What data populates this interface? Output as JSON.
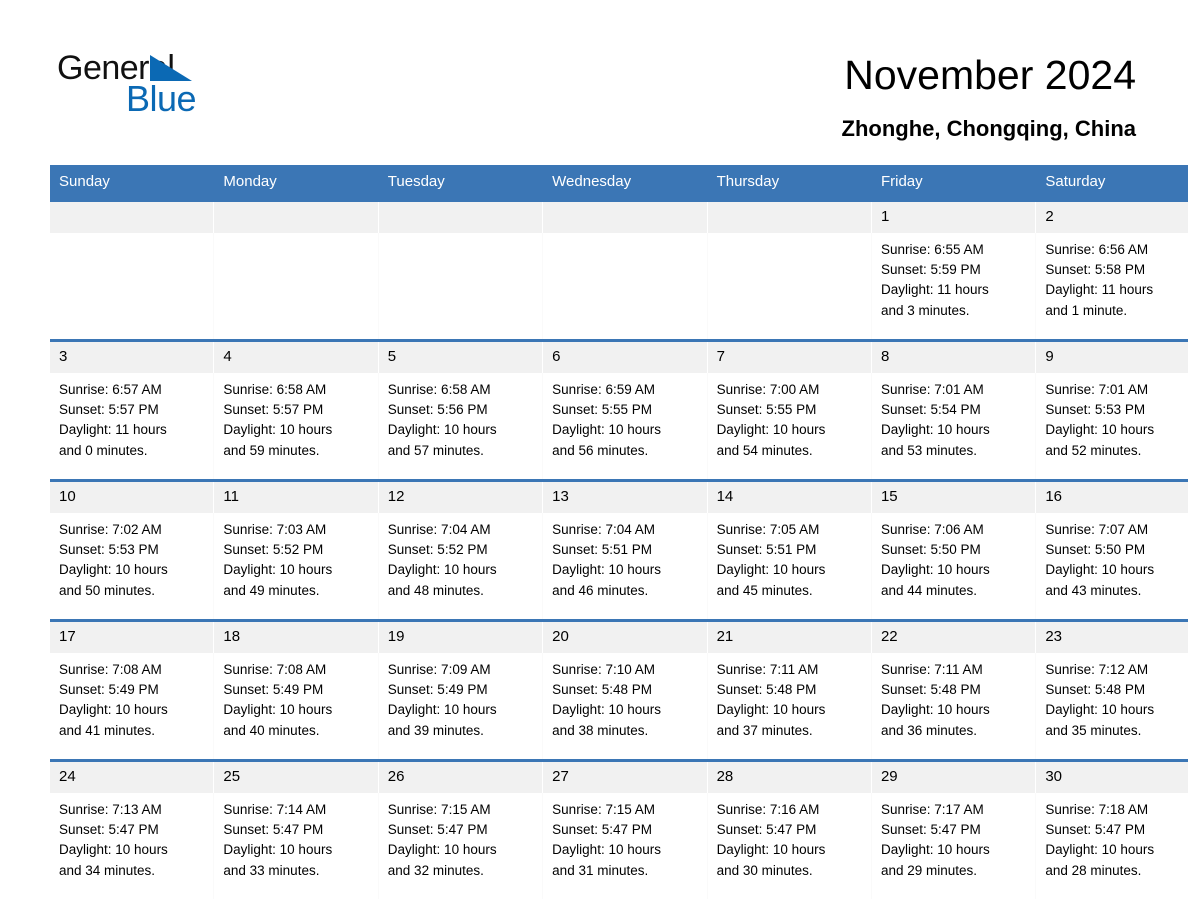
{
  "brand": {
    "name_part1": "General",
    "name_part2": "Blue",
    "triangle_color": "#0b69b4"
  },
  "header": {
    "title": "November 2024",
    "subtitle": "Zhonghe, Chongqing, China",
    "accent_color": "#3b76b5",
    "daynum_band_color": "#f1f1f1"
  },
  "weekday_headers": [
    "Sunday",
    "Monday",
    "Tuesday",
    "Wednesday",
    "Thursday",
    "Friday",
    "Saturday"
  ],
  "weeks": [
    [
      {
        "day": "",
        "sunrise": "",
        "sunset": "",
        "daylight1": "",
        "daylight2": ""
      },
      {
        "day": "",
        "sunrise": "",
        "sunset": "",
        "daylight1": "",
        "daylight2": ""
      },
      {
        "day": "",
        "sunrise": "",
        "sunset": "",
        "daylight1": "",
        "daylight2": ""
      },
      {
        "day": "",
        "sunrise": "",
        "sunset": "",
        "daylight1": "",
        "daylight2": ""
      },
      {
        "day": "",
        "sunrise": "",
        "sunset": "",
        "daylight1": "",
        "daylight2": ""
      },
      {
        "day": "1",
        "sunrise": "Sunrise: 6:55 AM",
        "sunset": "Sunset: 5:59 PM",
        "daylight1": "Daylight: 11 hours",
        "daylight2": "and 3 minutes."
      },
      {
        "day": "2",
        "sunrise": "Sunrise: 6:56 AM",
        "sunset": "Sunset: 5:58 PM",
        "daylight1": "Daylight: 11 hours",
        "daylight2": "and 1 minute."
      }
    ],
    [
      {
        "day": "3",
        "sunrise": "Sunrise: 6:57 AM",
        "sunset": "Sunset: 5:57 PM",
        "daylight1": "Daylight: 11 hours",
        "daylight2": "and 0 minutes."
      },
      {
        "day": "4",
        "sunrise": "Sunrise: 6:58 AM",
        "sunset": "Sunset: 5:57 PM",
        "daylight1": "Daylight: 10 hours",
        "daylight2": "and 59 minutes."
      },
      {
        "day": "5",
        "sunrise": "Sunrise: 6:58 AM",
        "sunset": "Sunset: 5:56 PM",
        "daylight1": "Daylight: 10 hours",
        "daylight2": "and 57 minutes."
      },
      {
        "day": "6",
        "sunrise": "Sunrise: 6:59 AM",
        "sunset": "Sunset: 5:55 PM",
        "daylight1": "Daylight: 10 hours",
        "daylight2": "and 56 minutes."
      },
      {
        "day": "7",
        "sunrise": "Sunrise: 7:00 AM",
        "sunset": "Sunset: 5:55 PM",
        "daylight1": "Daylight: 10 hours",
        "daylight2": "and 54 minutes."
      },
      {
        "day": "8",
        "sunrise": "Sunrise: 7:01 AM",
        "sunset": "Sunset: 5:54 PM",
        "daylight1": "Daylight: 10 hours",
        "daylight2": "and 53 minutes."
      },
      {
        "day": "9",
        "sunrise": "Sunrise: 7:01 AM",
        "sunset": "Sunset: 5:53 PM",
        "daylight1": "Daylight: 10 hours",
        "daylight2": "and 52 minutes."
      }
    ],
    [
      {
        "day": "10",
        "sunrise": "Sunrise: 7:02 AM",
        "sunset": "Sunset: 5:53 PM",
        "daylight1": "Daylight: 10 hours",
        "daylight2": "and 50 minutes."
      },
      {
        "day": "11",
        "sunrise": "Sunrise: 7:03 AM",
        "sunset": "Sunset: 5:52 PM",
        "daylight1": "Daylight: 10 hours",
        "daylight2": "and 49 minutes."
      },
      {
        "day": "12",
        "sunrise": "Sunrise: 7:04 AM",
        "sunset": "Sunset: 5:52 PM",
        "daylight1": "Daylight: 10 hours",
        "daylight2": "and 48 minutes."
      },
      {
        "day": "13",
        "sunrise": "Sunrise: 7:04 AM",
        "sunset": "Sunset: 5:51 PM",
        "daylight1": "Daylight: 10 hours",
        "daylight2": "and 46 minutes."
      },
      {
        "day": "14",
        "sunrise": "Sunrise: 7:05 AM",
        "sunset": "Sunset: 5:51 PM",
        "daylight1": "Daylight: 10 hours",
        "daylight2": "and 45 minutes."
      },
      {
        "day": "15",
        "sunrise": "Sunrise: 7:06 AM",
        "sunset": "Sunset: 5:50 PM",
        "daylight1": "Daylight: 10 hours",
        "daylight2": "and 44 minutes."
      },
      {
        "day": "16",
        "sunrise": "Sunrise: 7:07 AM",
        "sunset": "Sunset: 5:50 PM",
        "daylight1": "Daylight: 10 hours",
        "daylight2": "and 43 minutes."
      }
    ],
    [
      {
        "day": "17",
        "sunrise": "Sunrise: 7:08 AM",
        "sunset": "Sunset: 5:49 PM",
        "daylight1": "Daylight: 10 hours",
        "daylight2": "and 41 minutes."
      },
      {
        "day": "18",
        "sunrise": "Sunrise: 7:08 AM",
        "sunset": "Sunset: 5:49 PM",
        "daylight1": "Daylight: 10 hours",
        "daylight2": "and 40 minutes."
      },
      {
        "day": "19",
        "sunrise": "Sunrise: 7:09 AM",
        "sunset": "Sunset: 5:49 PM",
        "daylight1": "Daylight: 10 hours",
        "daylight2": "and 39 minutes."
      },
      {
        "day": "20",
        "sunrise": "Sunrise: 7:10 AM",
        "sunset": "Sunset: 5:48 PM",
        "daylight1": "Daylight: 10 hours",
        "daylight2": "and 38 minutes."
      },
      {
        "day": "21",
        "sunrise": "Sunrise: 7:11 AM",
        "sunset": "Sunset: 5:48 PM",
        "daylight1": "Daylight: 10 hours",
        "daylight2": "and 37 minutes."
      },
      {
        "day": "22",
        "sunrise": "Sunrise: 7:11 AM",
        "sunset": "Sunset: 5:48 PM",
        "daylight1": "Daylight: 10 hours",
        "daylight2": "and 36 minutes."
      },
      {
        "day": "23",
        "sunrise": "Sunrise: 7:12 AM",
        "sunset": "Sunset: 5:48 PM",
        "daylight1": "Daylight: 10 hours",
        "daylight2": "and 35 minutes."
      }
    ],
    [
      {
        "day": "24",
        "sunrise": "Sunrise: 7:13 AM",
        "sunset": "Sunset: 5:47 PM",
        "daylight1": "Daylight: 10 hours",
        "daylight2": "and 34 minutes."
      },
      {
        "day": "25",
        "sunrise": "Sunrise: 7:14 AM",
        "sunset": "Sunset: 5:47 PM",
        "daylight1": "Daylight: 10 hours",
        "daylight2": "and 33 minutes."
      },
      {
        "day": "26",
        "sunrise": "Sunrise: 7:15 AM",
        "sunset": "Sunset: 5:47 PM",
        "daylight1": "Daylight: 10 hours",
        "daylight2": "and 32 minutes."
      },
      {
        "day": "27",
        "sunrise": "Sunrise: 7:15 AM",
        "sunset": "Sunset: 5:47 PM",
        "daylight1": "Daylight: 10 hours",
        "daylight2": "and 31 minutes."
      },
      {
        "day": "28",
        "sunrise": "Sunrise: 7:16 AM",
        "sunset": "Sunset: 5:47 PM",
        "daylight1": "Daylight: 10 hours",
        "daylight2": "and 30 minutes."
      },
      {
        "day": "29",
        "sunrise": "Sunrise: 7:17 AM",
        "sunset": "Sunset: 5:47 PM",
        "daylight1": "Daylight: 10 hours",
        "daylight2": "and 29 minutes."
      },
      {
        "day": "30",
        "sunrise": "Sunrise: 7:18 AM",
        "sunset": "Sunset: 5:47 PM",
        "daylight1": "Daylight: 10 hours",
        "daylight2": "and 28 minutes."
      }
    ]
  ]
}
